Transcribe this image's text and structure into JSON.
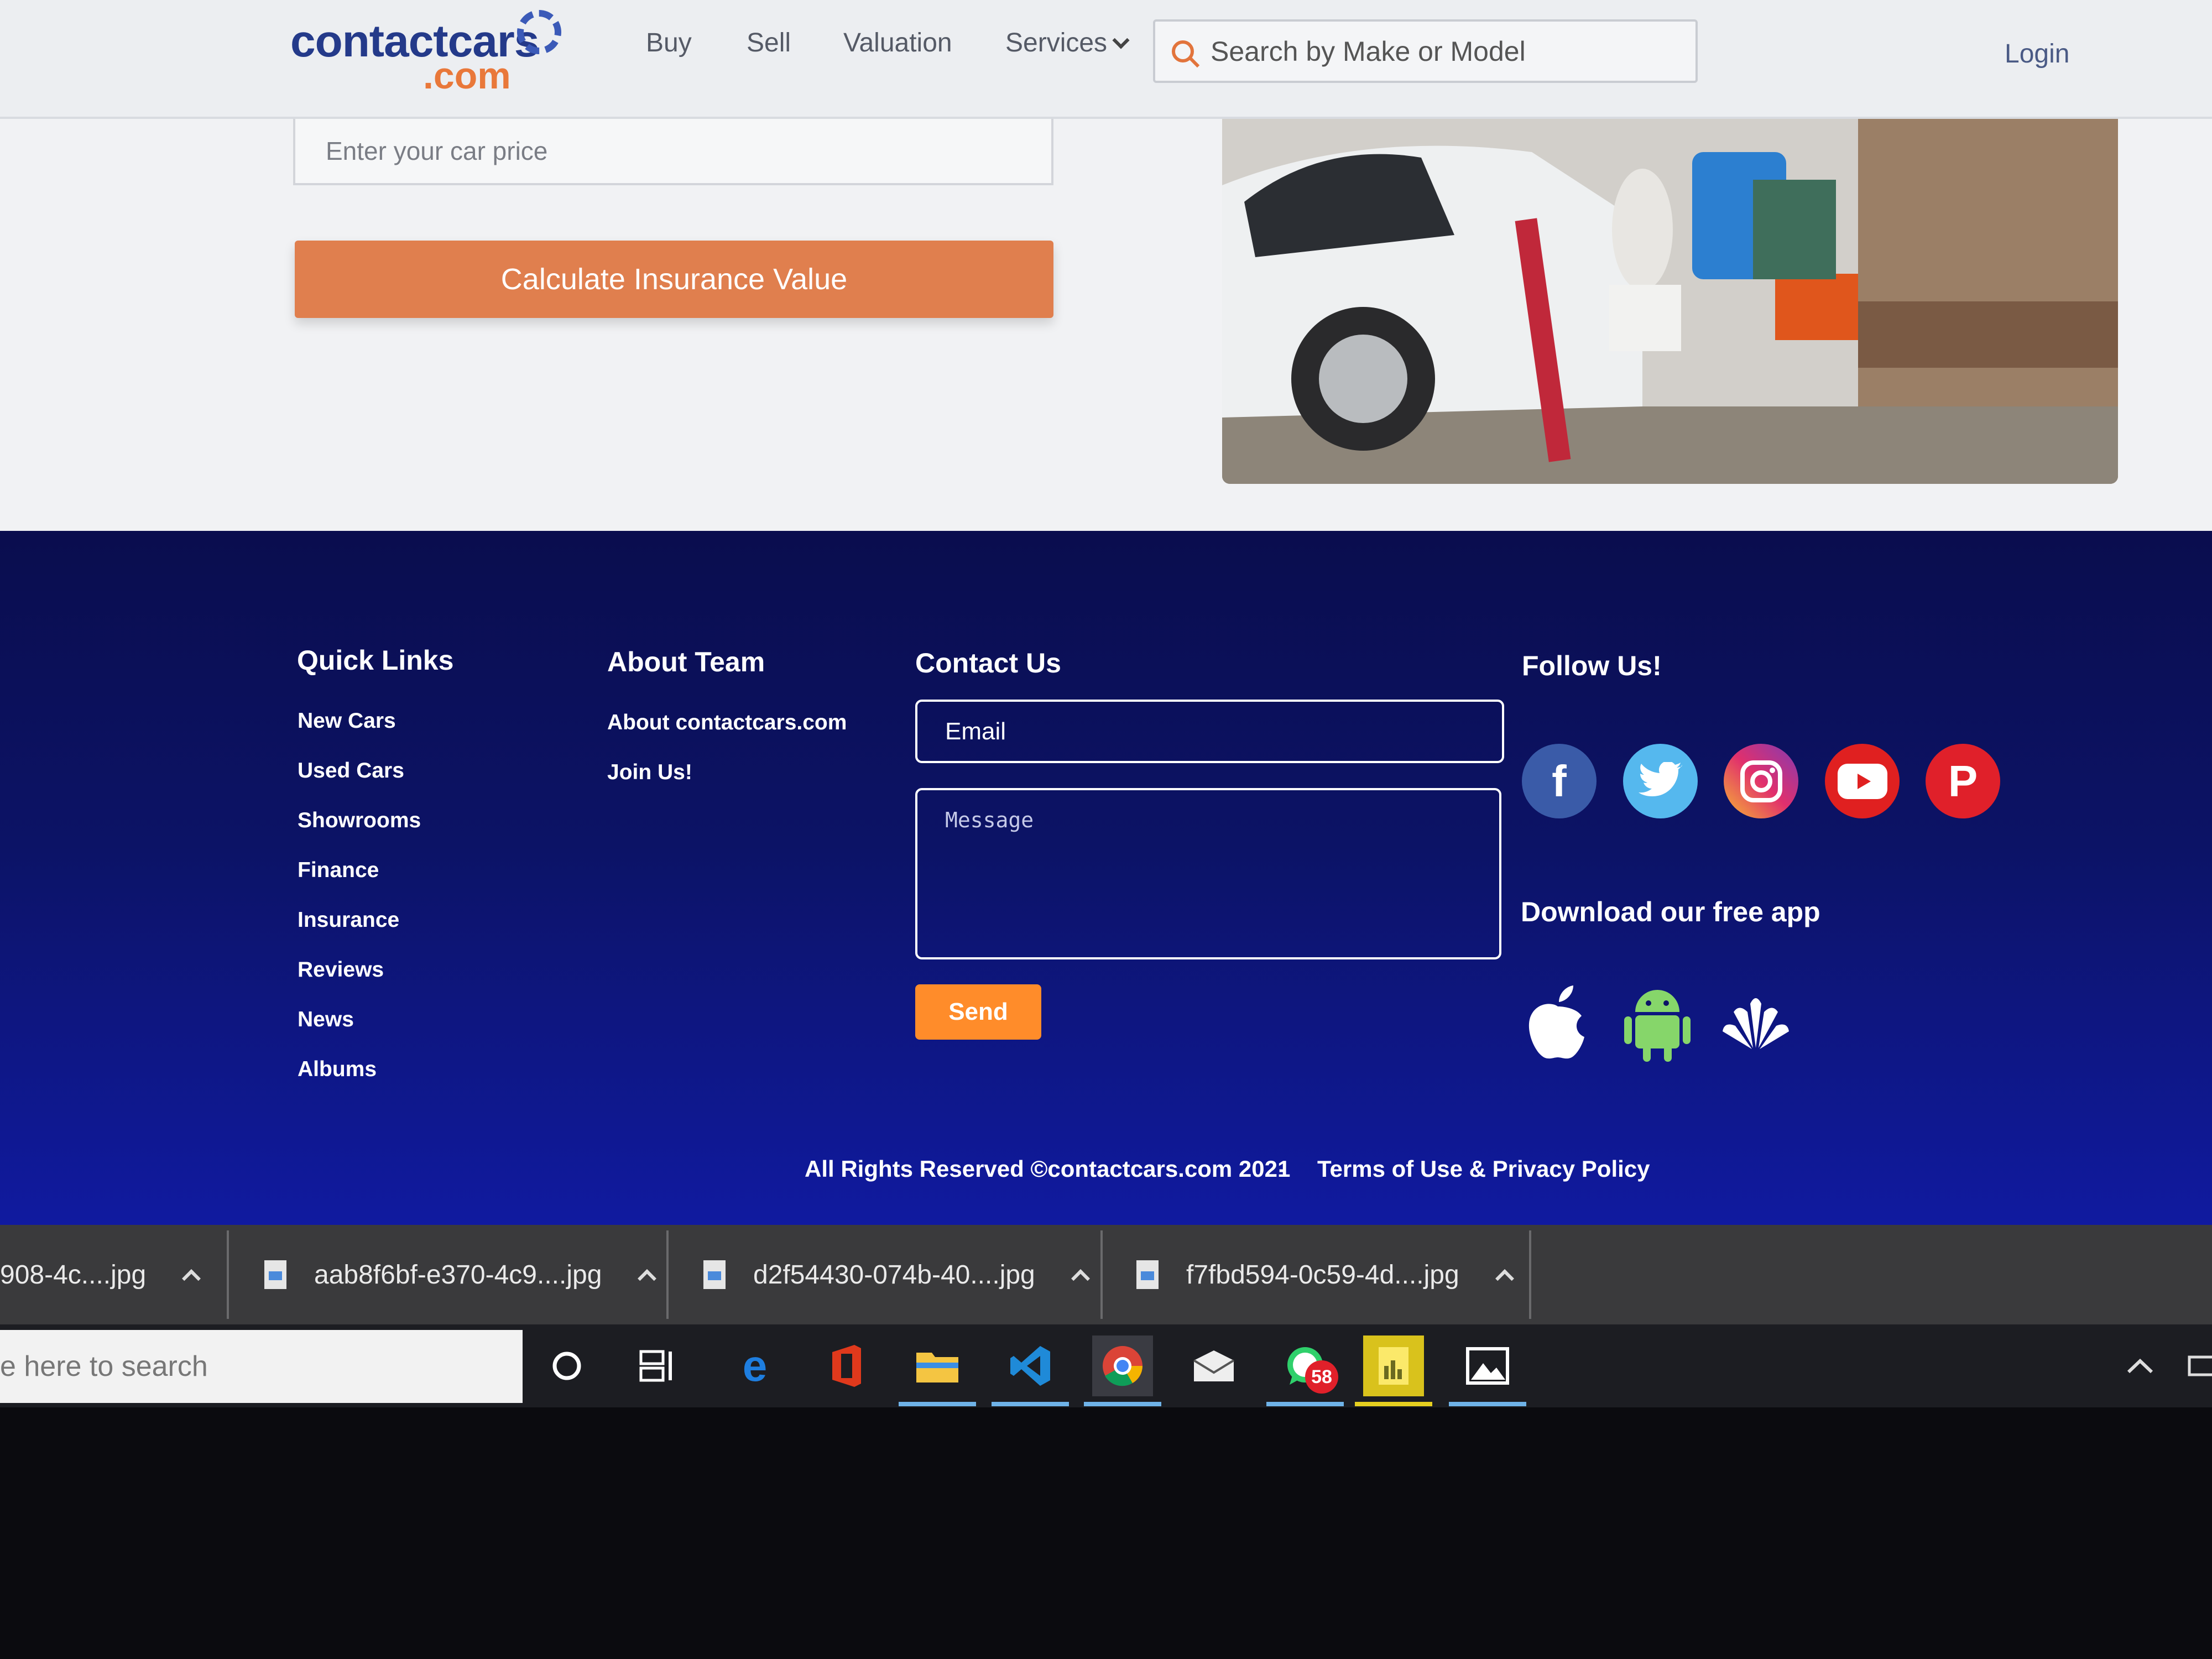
{
  "header": {
    "logo_top": "contactcars",
    "logo_bottom": ".com",
    "nav": [
      "Buy",
      "Sell",
      "Valuation",
      "Services"
    ],
    "search_placeholder": "Search by Make or Model",
    "login": "Login"
  },
  "main": {
    "price_placeholder": "Enter your car price",
    "calculate_button": "Calculate Insurance Value"
  },
  "footer": {
    "quick_links_title": "Quick Links",
    "quick_links": [
      "New Cars",
      "Used Cars",
      "Showrooms",
      "Finance",
      "Insurance",
      "Reviews",
      "News",
      "Albums"
    ],
    "about_title": "About Team",
    "about_links": [
      "About contactcars.com",
      "Join Us!"
    ],
    "contact_title": "Contact Us",
    "email_placeholder": "Email",
    "message_placeholder": "Message",
    "send_button": "Send",
    "follow_title": "Follow Us!",
    "social_icons": [
      "facebook-icon",
      "twitter-icon",
      "instagram-icon",
      "youtube-icon",
      "pinterest-icon"
    ],
    "download_title": "Download our free app",
    "app_icons": [
      "apple-icon",
      "android-icon",
      "huawei-icon"
    ],
    "copyright": "All Rights Reserved ©contactcars.com 2021",
    "separator": "-",
    "terms": "Terms of Use & Privacy Policy"
  },
  "downloads": [
    "908-4c....jpg",
    "aab8f6bf-e370-4c9....jpg",
    "d2f54430-074b-40....jpg",
    "f7fbd594-0c59-4d....jpg"
  ],
  "taskbar": {
    "search_text": "e here to search",
    "whatsapp_badge": "58"
  },
  "colors": {
    "brand_blue": "#243a8a",
    "brand_orange": "#e9783a",
    "footer_bg": "#0c1366",
    "send_orange": "#ff8c2a"
  }
}
